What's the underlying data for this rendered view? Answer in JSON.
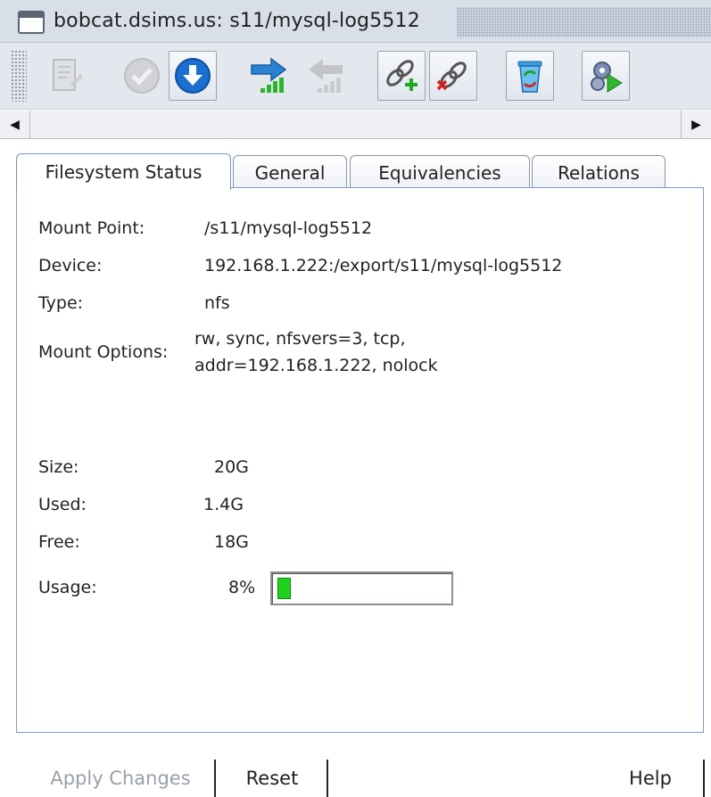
{
  "window": {
    "title": "bobcat.dsims.us: s11/mysql-log5512"
  },
  "toolbar": {
    "buttons": [
      {
        "icon": "edit-document-icon",
        "enabled": false
      },
      {
        "icon": "check-circle-icon",
        "enabled": false
      },
      {
        "icon": "download-arrow-icon",
        "enabled": true
      },
      {
        "icon": "arrow-right-signal-icon",
        "enabled": true
      },
      {
        "icon": "arrow-left-signal-icon",
        "enabled": false
      },
      {
        "icon": "link-add-icon",
        "enabled": true
      },
      {
        "icon": "link-remove-icon",
        "enabled": true
      },
      {
        "icon": "recycle-bin-icon",
        "enabled": true
      },
      {
        "icon": "gear-run-icon",
        "enabled": true
      }
    ]
  },
  "tabs": [
    {
      "label": "Filesystem Status",
      "active": true
    },
    {
      "label": "General",
      "active": false
    },
    {
      "label": "Equivalencies",
      "active": false
    },
    {
      "label": "Relations",
      "active": false
    }
  ],
  "status": {
    "mount_point_label": "Mount Point:",
    "mount_point": "/s11/mysql-log5512",
    "device_label": "Device:",
    "device": "192.168.1.222:/export/s11/mysql-log5512",
    "type_label": "Type:",
    "type": "nfs",
    "mount_options_label": "Mount Options:",
    "mount_options_line1": "rw, sync, nfsvers=3, tcp,",
    "mount_options_line2": "addr=192.168.1.222, nolock",
    "size_label": "Size:",
    "size": "20G",
    "used_label": "Used:",
    "used": "1.4G",
    "free_label": "Free:",
    "free": "18G",
    "usage_label": "Usage:",
    "usage_text": "8%",
    "usage_percent": 8,
    "usage_color": "#1ed21e"
  },
  "footer": {
    "apply_label": "Apply Changes",
    "reset_label": "Reset",
    "help_label": "Help"
  }
}
